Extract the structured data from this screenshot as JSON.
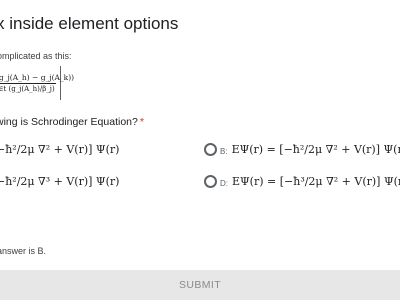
{
  "title": "x inside element options",
  "intro": "omplicated as this:",
  "formula": {
    "numerator": "(g_j(A_h) − g_j(A_k))",
    "denominator": "i∈t (g_j(A_h)/β_j)"
  },
  "question": {
    "text": "wing is Schrodinger Equation?",
    "required_mark": "*"
  },
  "options": {
    "a": {
      "letter": "",
      "equation": "−ħ²/2μ ∇² + V(r)] Ψ(r)"
    },
    "b": {
      "letter": "B:",
      "equation": "EΨ(r) = [−ħ²/2μ ∇² + V(r)] Ψ(r)"
    },
    "c": {
      "letter": "",
      "equation": "−ħ²/2μ ∇³ + V(r)] Ψ(r)"
    },
    "d": {
      "letter": "D:",
      "equation": "EΨ(r) = [−ħ³/2μ ∇² + V(r)] Ψ(r)"
    }
  },
  "answer_note": "answer is B.",
  "submit_label": "SUBMIT",
  "colors": {
    "required": "#d93025",
    "submit_bg": "#e7e7e7",
    "submit_text": "#8a8a8a"
  }
}
